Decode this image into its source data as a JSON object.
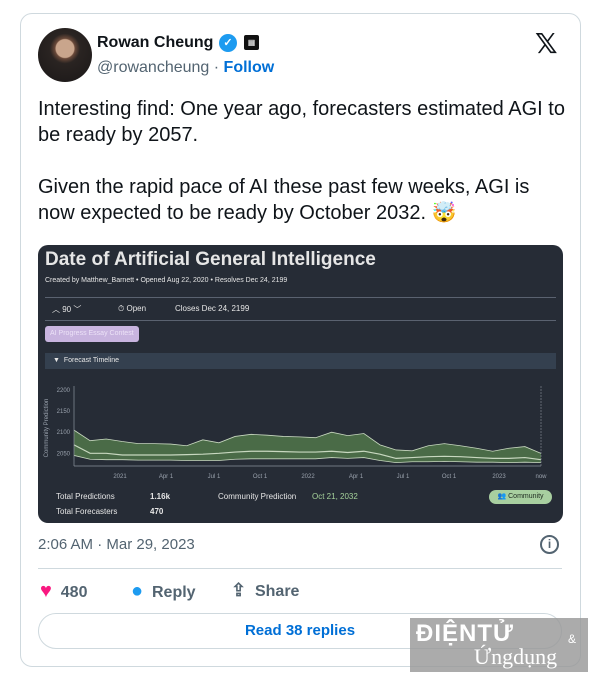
{
  "tweet": {
    "author_name": "Rowan Cheung",
    "handle": "@rowancheung",
    "follow_label": "Follow",
    "separator": "·",
    "text": "Interesting find: One year ago, forecasters estimated AGI to be ready by 2057.\n\nGiven the rapid pace of AI these past few weeks, AGI is now expected to be ready by October 2032. 🤯",
    "timestamp": "2:06 AM · Mar 29, 2023",
    "likes": "480",
    "reply_label": "Reply",
    "share_label": "Share",
    "read_replies_label": "Read 38 replies",
    "colors": {
      "like": "#f91880",
      "reply": "#1d9bf0",
      "link": "#006fd6",
      "verified": "#1d9bf0"
    }
  },
  "embedded": {
    "title": "Date of Artificial General Intelligence",
    "subtitle": "Created by Matthew_Barnett • Opened Aug 22, 2020 • Resolves Dec 24, 2199",
    "votes": "90",
    "status": "Open",
    "closes": "Closes Dec 24, 2199",
    "tag": "AI Progress Essay Contest",
    "section": "Forecast Timeline",
    "total_predictions_label": "Total Predictions",
    "total_predictions": "1.16k",
    "total_forecasters_label": "Total Forecasters",
    "total_forecasters": "470",
    "community_prediction_label": "Community Prediction",
    "community_prediction": "Oct 21, 2032",
    "community_button": "Community"
  },
  "chart_data": {
    "type": "area",
    "ylabel": "Community Prediction",
    "ylim": [
      2020,
      2200
    ],
    "yticks": [
      "2200",
      "2150",
      "2100",
      "2050"
    ],
    "xtick_labels": [
      "2021",
      "Apr 1",
      "Jul 1",
      "Oct 1",
      "2022",
      "Apr 1",
      "Jul 1",
      "Oct 1",
      "2023",
      "now"
    ],
    "x": [
      "2020-10",
      "2020-11",
      "2020-12",
      "2021-01",
      "2021-02",
      "2021-03",
      "2021-04",
      "2021-05",
      "2021-06",
      "2021-07",
      "2021-08",
      "2021-09",
      "2021-10",
      "2021-11",
      "2021-12",
      "2022-01",
      "2022-02",
      "2022-03",
      "2022-04",
      "2022-05",
      "2022-06",
      "2022-07",
      "2022-08",
      "2022-09",
      "2022-10",
      "2022-11",
      "2022-12",
      "2023-01",
      "2023-02",
      "2023-03"
    ],
    "upper": [
      2105,
      2080,
      2084,
      2078,
      2073,
      2073,
      2072,
      2068,
      2082,
      2075,
      2090,
      2095,
      2093,
      2090,
      2089,
      2087,
      2100,
      2092,
      2097,
      2070,
      2058,
      2056,
      2068,
      2073,
      2068,
      2062,
      2055,
      2062,
      2066,
      2050
    ],
    "median": [
      2070,
      2050,
      2050,
      2046,
      2046,
      2046,
      2046,
      2047,
      2048,
      2050,
      2053,
      2055,
      2055,
      2054,
      2053,
      2053,
      2055,
      2052,
      2055,
      2048,
      2038,
      2040,
      2042,
      2043,
      2042,
      2040,
      2038,
      2038,
      2040,
      2035
    ],
    "lower": [
      2045,
      2036,
      2035,
      2035,
      2034,
      2034,
      2034,
      2033,
      2033,
      2033,
      2036,
      2037,
      2037,
      2037,
      2037,
      2037,
      2040,
      2038,
      2040,
      2033,
      2028,
      2030,
      2030,
      2031,
      2030,
      2029,
      2029,
      2028,
      2029,
      2028
    ],
    "colors": {
      "band": "#4a6b47",
      "line": "#c8d8c0"
    }
  },
  "watermark": {
    "line1": "ĐIỆNTỬ",
    "amp": "&",
    "line2": "Ứngdụng"
  }
}
